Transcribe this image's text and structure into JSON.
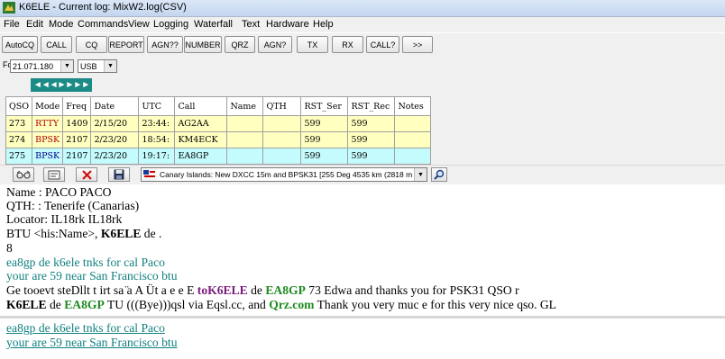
{
  "window": {
    "title": "K6ELE - Current log: MixW2.log(CSV)"
  },
  "menu": [
    "File",
    "Edit",
    "Mode",
    "Commands",
    "View",
    "Logging",
    "Waterfall",
    "Text",
    "Hardware",
    "Help"
  ],
  "toolbar": [
    "AutoCQ",
    "CALL",
    "CQ",
    "REPORT",
    "AGN??",
    "NUMBER",
    "QRZ",
    "AGN?",
    "TX",
    "RX",
    "CALL?",
    ">>"
  ],
  "freq": {
    "label": "Fq",
    "value": "21.071.180",
    "mode": "USB"
  },
  "arrows": "◄◄◄►►►►",
  "log": {
    "headers": [
      "QSO",
      "Mode",
      "Freq",
      "Date",
      "UTC",
      "Call",
      "Name",
      "QTH",
      "RST_Ser",
      "RST_Rec",
      "Notes"
    ],
    "rows": [
      [
        "273",
        "RTTY",
        "1409",
        "2/15/20",
        "23:44:",
        "AG2AA",
        "",
        "",
        "599",
        "599",
        ""
      ],
      [
        "274",
        "BPSK",
        "2107",
        "2/23/20",
        "18:54:",
        "KM4ECK",
        "",
        "",
        "599",
        "599",
        ""
      ],
      [
        "275",
        "BPSK",
        "2107",
        "2/23/20",
        "19:17:",
        "EA8GP",
        "",
        "",
        "599",
        "599",
        ""
      ]
    ]
  },
  "bottombar": {
    "info": "Canary Islands:  New DXCC 15m and BPSK31 [255 Deg  4535 km (2818 m"
  },
  "text": {
    "l1": "Name   : PACO PACO",
    "l2": "QTH:  : Tenerife (Canarias)",
    "l3": "Locator: IL18rk  IL18rk",
    "l4a": "BTU <his:Name>, ",
    "l4b": "K6ELE",
    "l4c": " de .",
    "l5": "8",
    "l6": "ea8gp de k6ele tnks for cal Paco",
    "l7": "your are 59 near San Francisco btu",
    "l8a": "Ge tooevt steDllt t irt sa  ̈a    A   Üt a    e   e E ",
    "l8b": "toK6ELE",
    "l8c": " de ",
    "l8d": "EA8GP",
    "l8e": " 73 Edwa and thanks you for PSK31 QSO r",
    "l9a": "K6ELE",
    "l9b": " de ",
    "l9c": "EA8GP",
    "l9d": " TU (((Bye)))qsl via Eqsl.cc, and ",
    "l9e": "Qrz.com",
    "l9f": "  Thank you very muc e for this very nice qso. GL",
    "l10": "ea8gp de k6ele tnks for cal Paco",
    "l11": "your are 59 near San Francisco btu"
  }
}
